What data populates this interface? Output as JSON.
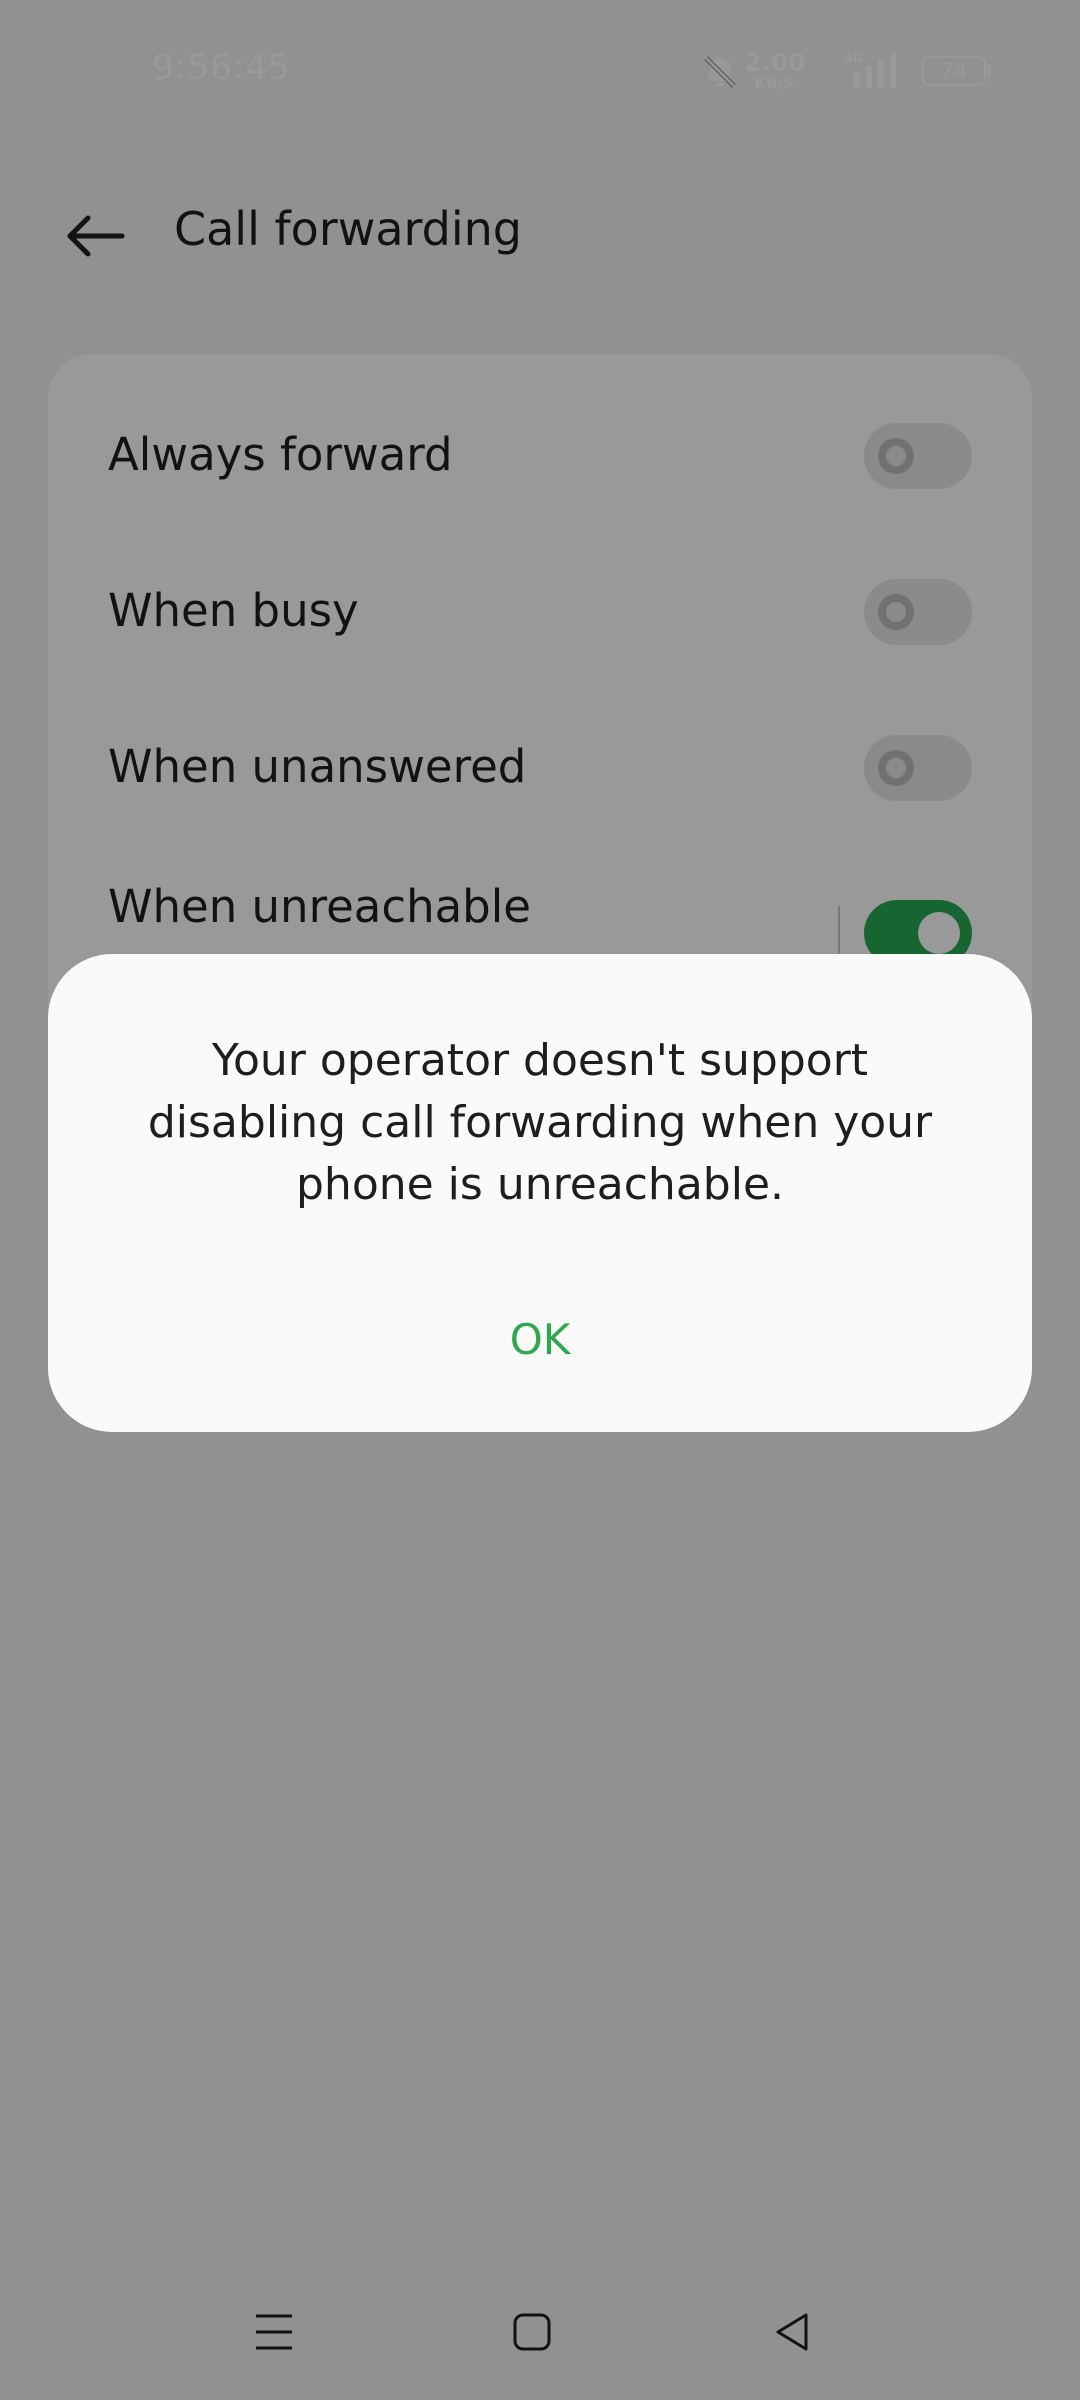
{
  "status_bar": {
    "time": "9:56:45",
    "net_speed_value": "2.00",
    "net_speed_unit": "KB/S",
    "network_type": "4G",
    "battery_level": "74",
    "icons": [
      "bell-off-icon",
      "signal-icon",
      "battery-icon"
    ]
  },
  "header": {
    "back_icon": "arrow-left-icon",
    "title": "Call forwarding"
  },
  "settings": {
    "items": [
      {
        "label": "Always forward",
        "enabled": false
      },
      {
        "label": "When busy",
        "enabled": false
      },
      {
        "label": "When unanswered",
        "enabled": false
      },
      {
        "label": "When unreachable",
        "enabled": true
      }
    ]
  },
  "dialog": {
    "message": "Your operator doesn't support disabling call forwarding when your phone is unreachable.",
    "ok_label": "OK"
  },
  "nav_bar": {
    "icons": [
      "menu-icon",
      "home-icon",
      "back-triangle-icon"
    ]
  },
  "colors": {
    "accent": "#2DA84F",
    "toggle_on": "#27A852",
    "toggle_off": "#E6E6E6",
    "background": "#F2F2F2",
    "dialog_background": "#FAFAFA"
  }
}
